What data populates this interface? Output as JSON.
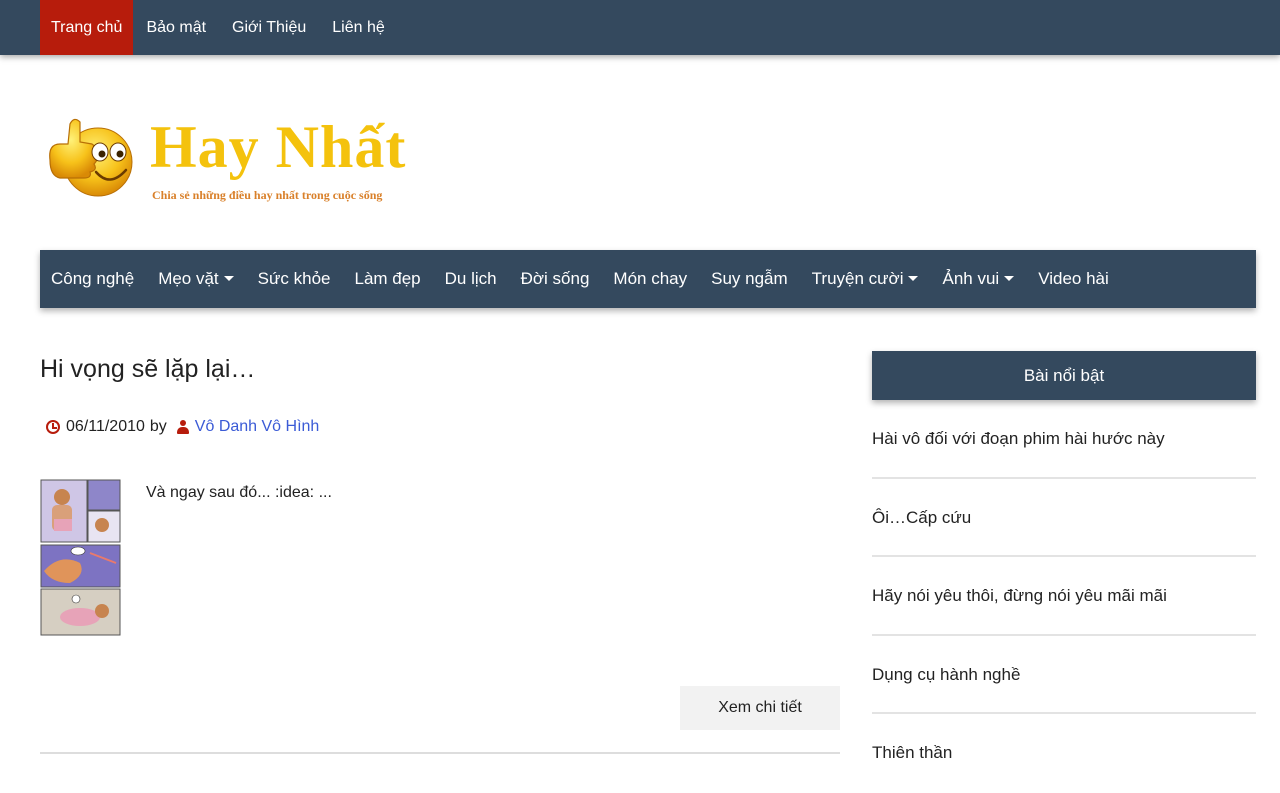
{
  "topnav": {
    "items": [
      {
        "label": "Trang chủ",
        "active": true
      },
      {
        "label": "Bảo mật"
      },
      {
        "label": "Giới Thiệu"
      },
      {
        "label": "Liên hệ"
      }
    ],
    "active_color": "#b71c0c"
  },
  "logo": {
    "title": "Hay Nhất",
    "tagline": "Chia sẻ những điều hay nhất trong cuộc sống",
    "icon": "thumbs-up-smiley-icon"
  },
  "catnav": {
    "items": [
      {
        "label": "Công nghệ"
      },
      {
        "label": "Mẹo vặt",
        "dropdown": true
      },
      {
        "label": "Sức khỏe"
      },
      {
        "label": "Làm đẹp"
      },
      {
        "label": "Du lịch"
      },
      {
        "label": "Đời sống"
      },
      {
        "label": "Món chay"
      },
      {
        "label": "Suy ngẫm"
      },
      {
        "label": "Truyện cười",
        "dropdown": true
      },
      {
        "label": "Ảnh vui",
        "dropdown": true
      },
      {
        "label": "Video hài"
      }
    ]
  },
  "post": {
    "title": "Hi vọng sẽ lặp lại…",
    "date": "06/11/2010",
    "by": "by",
    "author": "Vô Danh Vô Hình",
    "excerpt": "Và ngay sau đó... :idea: ...",
    "more_label": "Xem chi tiết"
  },
  "sidebar": {
    "heading": "Bài nổi bật",
    "items": [
      "Hài vô đối với đoạn phim hài hước này",
      "Ôi…Cấp cứu",
      "Hãy nói yêu thôi, đừng nói yêu mãi mãi",
      "Dụng cụ hành nghề",
      "Thiên thần"
    ]
  },
  "colors": {
    "nav_bg": "#34495e",
    "accent": "#b71c0c",
    "link": "#3b5bd6",
    "logo_gold": "#f4c20d"
  }
}
